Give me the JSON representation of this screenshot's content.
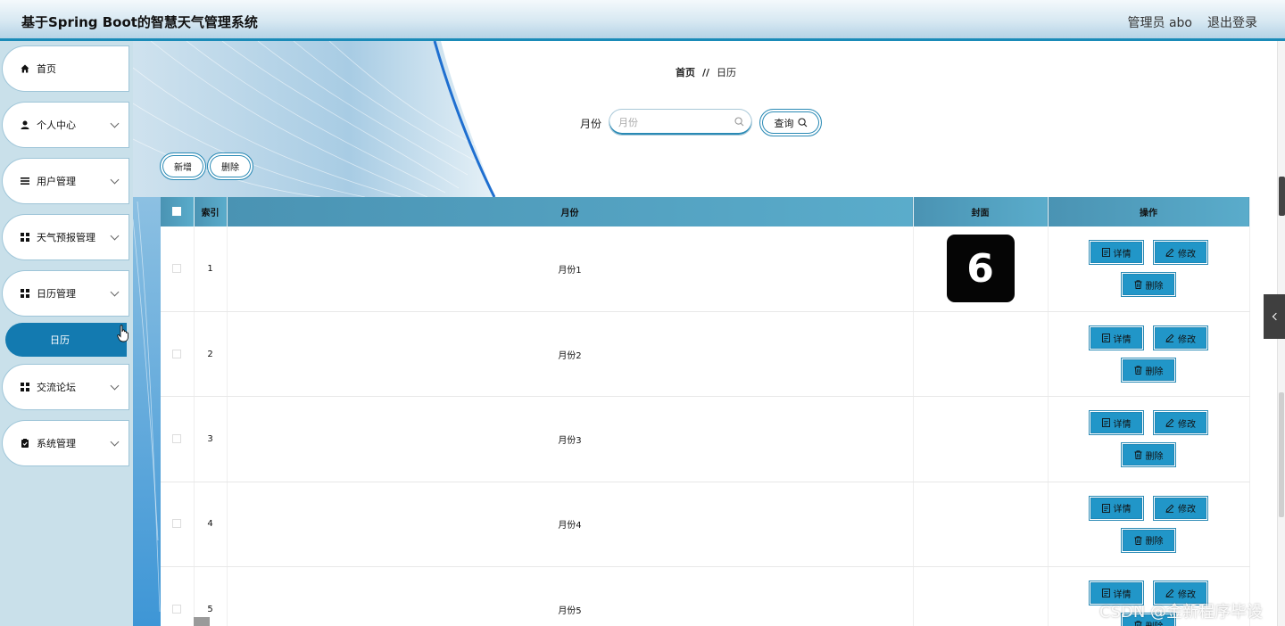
{
  "app": {
    "title": "基于Spring Boot的智慧天气管理系统"
  },
  "header": {
    "user": "管理员 abo",
    "logout": "退出登录"
  },
  "sidebar": {
    "items": [
      {
        "label": "首页",
        "icon": "home-icon",
        "expandable": false
      },
      {
        "label": "个人中心",
        "icon": "person-icon",
        "expandable": true
      },
      {
        "label": "用户管理",
        "icon": "list-icon",
        "expandable": true
      },
      {
        "label": "天气预报管理",
        "icon": "grid-icon",
        "expandable": true
      },
      {
        "label": "日历管理",
        "icon": "grid-icon",
        "expandable": true
      },
      {
        "label": "交流论坛",
        "icon": "grid-icon",
        "expandable": true
      },
      {
        "label": "系统管理",
        "icon": "clipboard-icon",
        "expandable": true
      }
    ],
    "active_sub": "日历"
  },
  "breadcrumb": {
    "home": "首页",
    "separator": "//",
    "current": "日历"
  },
  "search": {
    "label": "月份",
    "placeholder": "月份",
    "value": "",
    "button": "查询"
  },
  "actions": {
    "add": "新增",
    "delete": "删除"
  },
  "table": {
    "headers": {
      "index": "索引",
      "month": "月份",
      "cover": "封面",
      "ops": "操作"
    },
    "rows": [
      {
        "index": "1",
        "month": "月份1",
        "cover": "6"
      },
      {
        "index": "2",
        "month": "月份2",
        "cover": ""
      },
      {
        "index": "3",
        "month": "月份3",
        "cover": ""
      },
      {
        "index": "4",
        "month": "月份4",
        "cover": ""
      },
      {
        "index": "5",
        "month": "月份5",
        "cover": ""
      }
    ],
    "row_actions": {
      "detail": "详情",
      "edit": "修改",
      "delete": "删除"
    }
  },
  "watermark": "CSDN @金新程序毕设",
  "colors": {
    "accent": "#137ab0",
    "table_header": "#4a93b3",
    "action_button": "#2196c8",
    "sidebar_bg": "#c9e0ea"
  }
}
